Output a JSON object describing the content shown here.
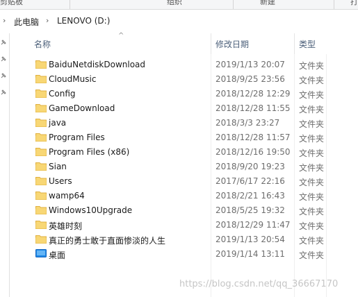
{
  "ribbon": {
    "left_label": "剪贴板",
    "mid_label": "组织",
    "right_label": "新建",
    "far_right_label": "打"
  },
  "address": {
    "crumbs": [
      "此电脑",
      "LENOVO (D:)"
    ]
  },
  "columns": {
    "name": "名称",
    "date": "修改日期",
    "type": "类型"
  },
  "rows": [
    {
      "name": "BaiduNetdiskDownload",
      "date": "2019/1/13 20:07",
      "type": "文件夹",
      "icon": "folder-icon"
    },
    {
      "name": "CloudMusic",
      "date": "2018/9/25 23:56",
      "type": "文件夹",
      "icon": "folder-icon"
    },
    {
      "name": "Config",
      "date": "2018/12/28 12:29",
      "type": "文件夹",
      "icon": "folder-icon"
    },
    {
      "name": "GameDownload",
      "date": "2018/12/28 11:55",
      "type": "文件夹",
      "icon": "folder-icon"
    },
    {
      "name": "java",
      "date": "2018/3/3 23:27",
      "type": "文件夹",
      "icon": "folder-icon"
    },
    {
      "name": "Program Files",
      "date": "2018/12/28 11:57",
      "type": "文件夹",
      "icon": "folder-icon"
    },
    {
      "name": "Program Files (x86)",
      "date": "2018/12/16 19:50",
      "type": "文件夹",
      "icon": "folder-icon"
    },
    {
      "name": "Sian",
      "date": "2018/9/20 19:23",
      "type": "文件夹",
      "icon": "folder-icon"
    },
    {
      "name": "Users",
      "date": "2017/6/17 22:16",
      "type": "文件夹",
      "icon": "folder-icon"
    },
    {
      "name": "wamp64",
      "date": "2018/2/21 16:43",
      "type": "文件夹",
      "icon": "folder-icon"
    },
    {
      "name": "Windows10Upgrade",
      "date": "2018/5/25 19:32",
      "type": "文件夹",
      "icon": "folder-icon"
    },
    {
      "name": "英雄时刻",
      "date": "2018/12/29 11:47",
      "type": "文件夹",
      "icon": "folder-icon"
    },
    {
      "name": "真正的勇士敢于直面惨淡的人生",
      "date": "2019/1/13 20:54",
      "type": "文件夹",
      "icon": "folder-icon"
    },
    {
      "name": "桌面",
      "date": "2019/1/14 13:11",
      "type": "文件夹",
      "icon": "desktop-folder-icon"
    }
  ],
  "watermark": "https://blog.csdn.net/qq_36667170",
  "colors": {
    "folder": "#f8d775",
    "folder_dark": "#e0b040",
    "desktop": "#1e88e5",
    "header_text": "#4c607a"
  }
}
